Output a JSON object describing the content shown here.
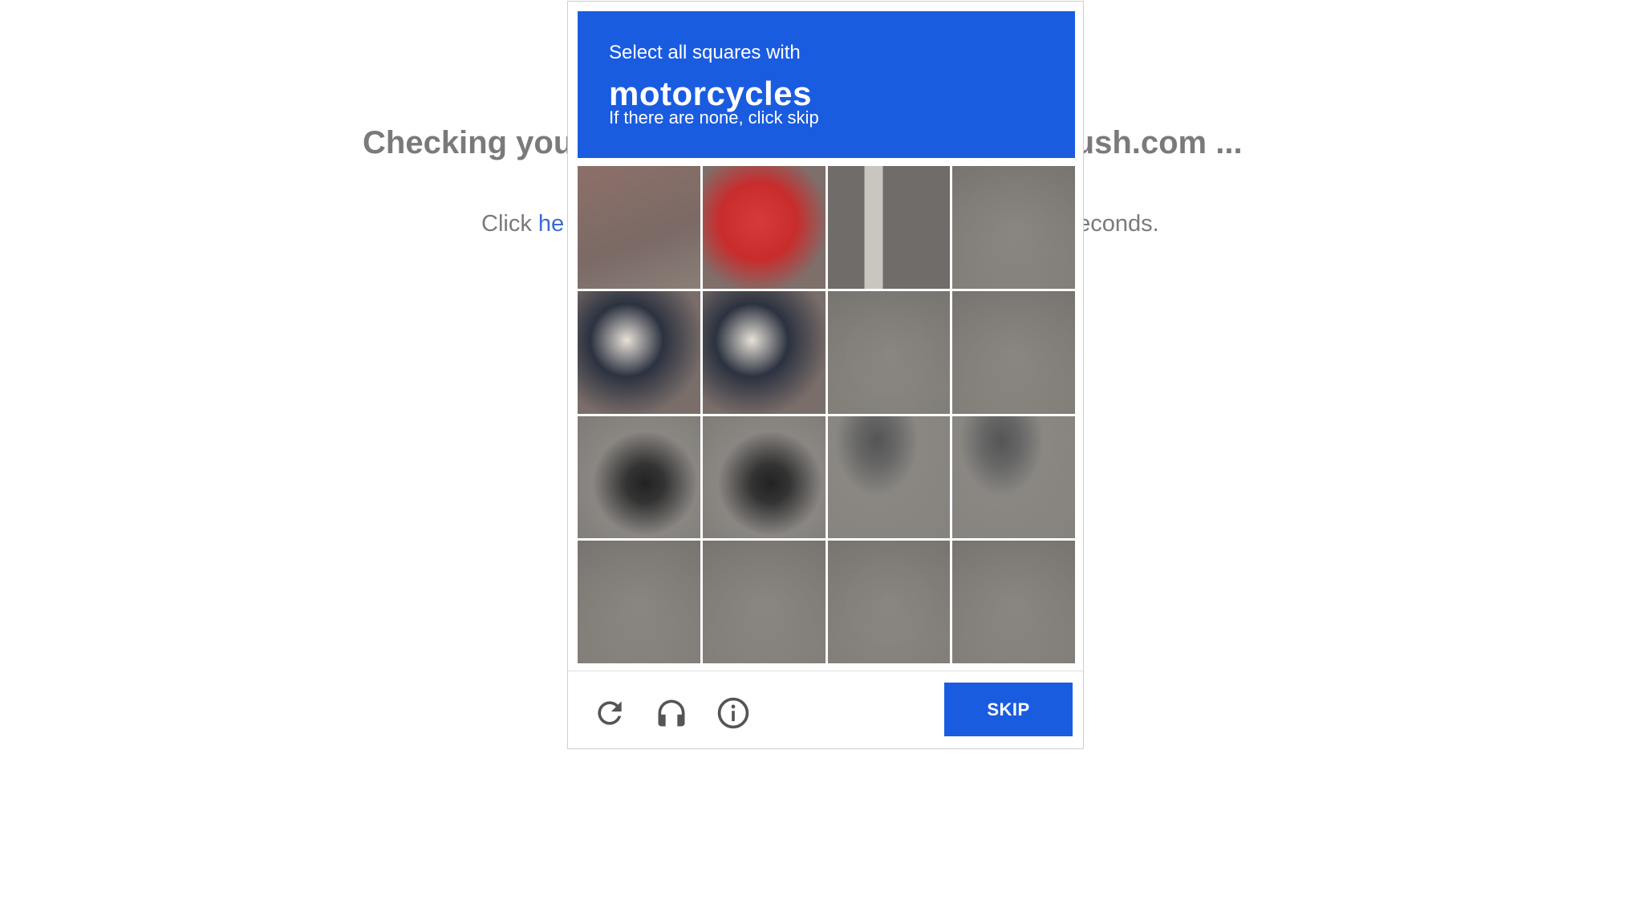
{
  "background": {
    "heading_left": "Checking you",
    "heading_right": "emrush.com ...",
    "subtext_prefix": "Click ",
    "subtext_link": "he",
    "subtext_suffix": "econds."
  },
  "captcha": {
    "instruction": "Select all squares with",
    "target": "motorcycles",
    "hint": "If there are none, click skip",
    "grid_rows": 4,
    "grid_cols": 4,
    "skip_label": "SKIP",
    "icons": [
      "reload-icon",
      "audio-icon",
      "info-icon"
    ],
    "colors": {
      "accent": "#1a5ce0"
    }
  }
}
